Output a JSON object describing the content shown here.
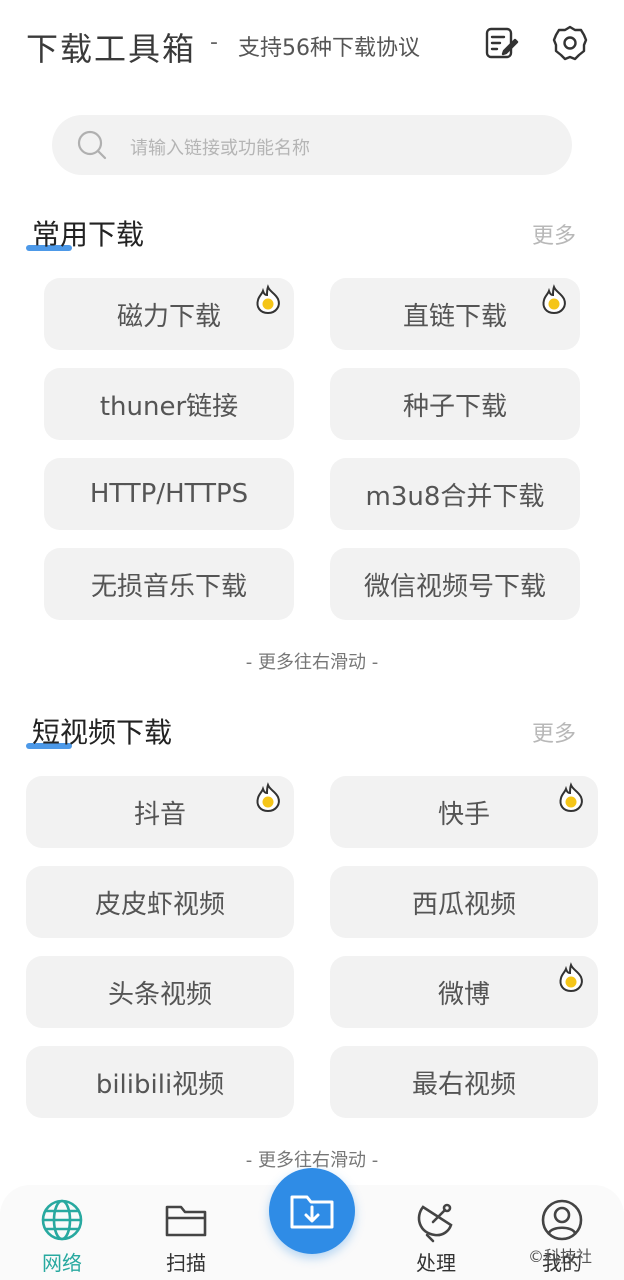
{
  "header": {
    "title": "下载工具箱",
    "dash": "-",
    "subtitle": "支持56种下载协议",
    "icons": [
      "edit-note-icon",
      "settings-gear-icon"
    ]
  },
  "search": {
    "placeholder": "请输入链接或功能名称",
    "icon": "search-icon"
  },
  "sections": [
    {
      "title": "常用下载",
      "more": "更多",
      "items": [
        {
          "label": "磁力下载",
          "hot": true
        },
        {
          "label": "直链下载",
          "hot": true
        },
        {
          "label": "thuner链接",
          "hot": false
        },
        {
          "label": "种子下载",
          "hot": false
        },
        {
          "label": "HTTP/HTTPS",
          "hot": false
        },
        {
          "label": "m3u8合并下载",
          "hot": false
        },
        {
          "label": "无损音乐下载",
          "hot": false
        },
        {
          "label": "微信视频号下载",
          "hot": false
        }
      ],
      "hint": "- 更多往右滑动 -"
    },
    {
      "title": "短视频下载",
      "more": "更多",
      "items": [
        {
          "label": "抖音",
          "hot": true
        },
        {
          "label": "快手",
          "hot": true
        },
        {
          "label": "皮皮虾视频",
          "hot": false
        },
        {
          "label": "西瓜视频",
          "hot": false
        },
        {
          "label": "头条视频",
          "hot": false
        },
        {
          "label": "微博",
          "hot": true
        },
        {
          "label": "bilibili视频",
          "hot": false
        },
        {
          "label": "最右视频",
          "hot": false
        }
      ],
      "hint": "- 更多往右滑动 -"
    }
  ],
  "nav": {
    "items": [
      {
        "label": "网络",
        "icon": "globe-icon",
        "active": true
      },
      {
        "label": "扫描",
        "icon": "folder-icon",
        "active": false
      },
      {
        "label": "",
        "icon": "download-folder-icon",
        "active": false
      },
      {
        "label": "处理",
        "icon": "satellite-dish-icon",
        "active": false
      },
      {
        "label": "我的",
        "icon": "user-icon",
        "active": false
      }
    ]
  },
  "watermark": "©科技社",
  "colors": {
    "accent": "#2f8ce6",
    "active_nav": "#28a9a0",
    "tile_bg": "#f2f2f2",
    "fire": "#f5c518",
    "underline": "#3a8ee6"
  }
}
